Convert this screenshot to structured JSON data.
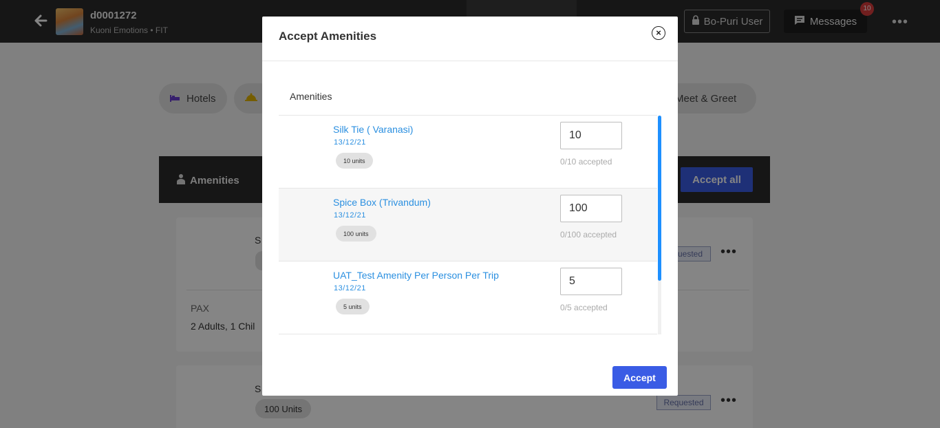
{
  "topbar": {
    "trip_id": "d0001272",
    "trip_sub": "Kuoni Emotions • FIT",
    "user_label": "Bo-Puri User",
    "messages_label": "Messages",
    "messages_count": "10"
  },
  "chips": {
    "hotels": "Hotels",
    "meet_greet": "Meet & Greet"
  },
  "panel": {
    "title": "Amenities",
    "accept_all": "Accept all"
  },
  "bg_cards": {
    "card1_letter": "S",
    "card1_status": "uested",
    "pax_label": "PAX",
    "pax_value": "2 Adults, 1 Chil",
    "card2_letter": "S",
    "card2_units": "100 Units",
    "card2_status": "Requested"
  },
  "modal": {
    "title": "Accept Amenities",
    "list_header": "Amenities",
    "accept_button": "Accept",
    "items": [
      {
        "name": "Silk Tie ( Varanasi)",
        "date": "13/12/21",
        "units": "10 units",
        "value": "10",
        "accepted": "0/10 accepted"
      },
      {
        "name": "Spice Box (Trivandum)",
        "date": "13/12/21",
        "units": "100 units",
        "value": "100",
        "accepted": "0/100 accepted"
      },
      {
        "name": "UAT_Test Amenity Per Person Per Trip",
        "date": "13/12/21",
        "units": "5 units",
        "value": "5",
        "accepted": "0/5 accepted"
      }
    ]
  },
  "colors": {
    "link": "#2a8fe0",
    "primary": "#3a5ce5",
    "badge": "#d93d3d",
    "scrollbar": "#1e90ff"
  }
}
